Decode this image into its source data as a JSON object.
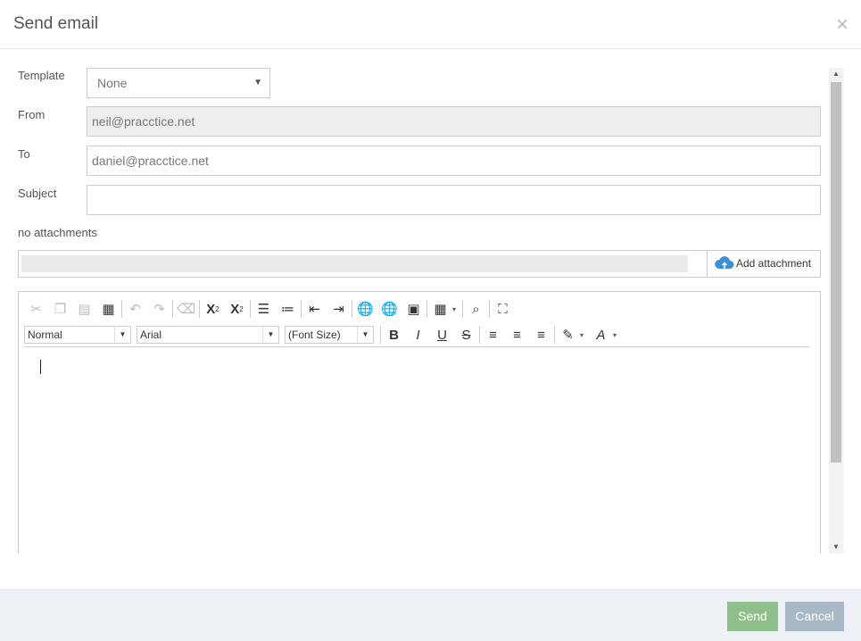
{
  "dialog": {
    "title": "Send email",
    "close_glyph": "×"
  },
  "form": {
    "template_label": "Template",
    "template_value": "None",
    "from_label": "From",
    "from_value": "neil@pracctice.net",
    "to_label": "To",
    "to_value": "daniel@pracctice.net",
    "subject_label": "Subject",
    "subject_value": "",
    "attachments_text": "no attachments",
    "add_attachment_label": "Add attachment"
  },
  "editor": {
    "format_value": "Normal",
    "font_value": "Arial",
    "size_value": "(Font Size)",
    "toolbar_row1": [
      "cut-icon",
      "copy-icon",
      "paste-icon",
      "paste-from-word-icon",
      "undo-icon",
      "redo-icon",
      "remove-format-icon",
      "superscript-icon",
      "subscript-icon",
      "numbered-list-icon",
      "bulleted-list-icon",
      "decrease-indent-icon",
      "increase-indent-icon",
      "link-icon",
      "unlink-icon",
      "image-icon",
      "table-icon",
      "preview-icon",
      "maximize-icon"
    ],
    "toolbar_row2": [
      "bold-icon",
      "italic-icon",
      "underline-icon",
      "strikethrough-icon",
      "align-left-icon",
      "align-center-icon",
      "align-right-icon",
      "spellcheck-icon",
      "text-color-icon"
    ]
  },
  "footer": {
    "send_label": "Send",
    "cancel_label": "Cancel"
  },
  "colors": {
    "send": "#8fbf8a",
    "cancel": "#a9b8c5",
    "cloud": "#3a8fd6"
  }
}
